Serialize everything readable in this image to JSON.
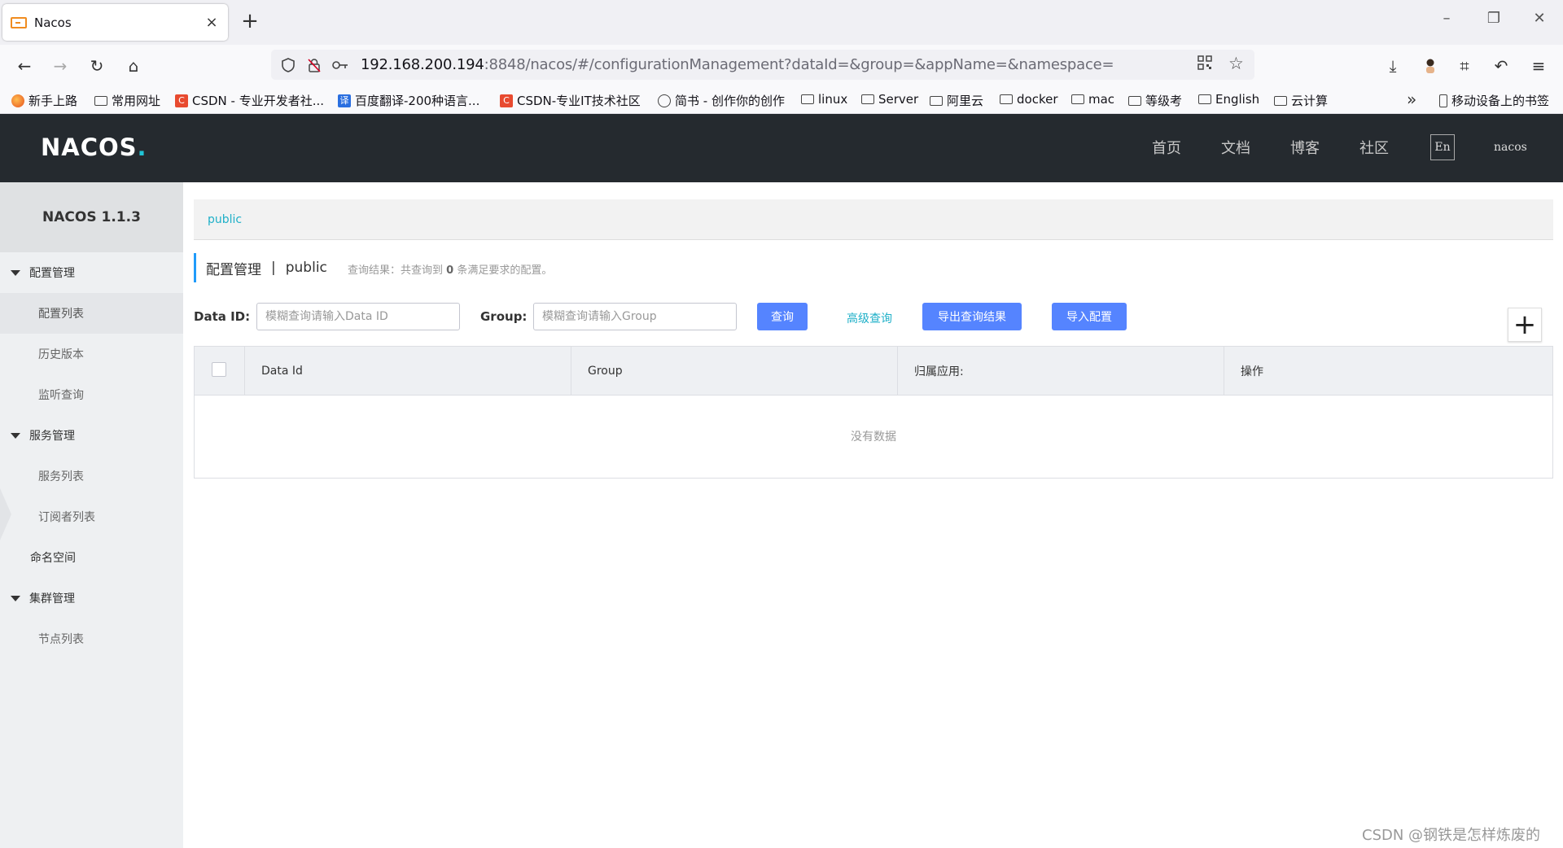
{
  "browser": {
    "tab_title": "Nacos",
    "tab_close": "×",
    "new_tab": "+",
    "url_host": "192.168.200.194",
    "url_rest": ":8848/nacos/#/configurationManagement?dataId=&group=&appName=&namespace=",
    "bookmarks": [
      {
        "label": "新手上路",
        "icon": "firefox-icon"
      },
      {
        "label": "常用网址",
        "icon": "folder-icon"
      },
      {
        "label": "CSDN - 专业开发者社...",
        "icon": "csdn-icon"
      },
      {
        "label": "百度翻译-200种语言...",
        "icon": "fanyi-icon"
      },
      {
        "label": "CSDN-专业IT技术社区",
        "icon": "csdn-icon"
      },
      {
        "label": "简书 - 创作你的创作",
        "icon": "globe-icon"
      },
      {
        "label": "linux",
        "icon": "folder-icon"
      },
      {
        "label": "Server",
        "icon": "folder-icon"
      },
      {
        "label": "阿里云",
        "icon": "folder-icon"
      },
      {
        "label": "docker",
        "icon": "folder-icon"
      },
      {
        "label": "mac",
        "icon": "folder-icon"
      },
      {
        "label": "等级考",
        "icon": "folder-icon"
      },
      {
        "label": "English",
        "icon": "folder-icon"
      },
      {
        "label": "云计算",
        "icon": "folder-icon"
      }
    ],
    "mobile_bookmarks": "移动设备上的书签"
  },
  "header": {
    "logo_text": "NACOS",
    "logo_dot": ".",
    "nav": [
      "首页",
      "文档",
      "博客",
      "社区"
    ],
    "lang": "En",
    "user": "nacos"
  },
  "sidebar": {
    "title": "NACOS 1.1.3",
    "groups": [
      {
        "label": "配置管理",
        "items": [
          "配置列表",
          "历史版本",
          "监听查询"
        ]
      },
      {
        "label": "服务管理",
        "items": [
          "服务列表",
          "订阅者列表"
        ]
      },
      {
        "label": "命名空间"
      },
      {
        "label": "集群管理",
        "items": [
          "节点列表"
        ]
      }
    ]
  },
  "main": {
    "namespace_tab": "public",
    "title": "配置管理",
    "title_sep": "|",
    "title_namespace": "public",
    "query_result_prefix": "查询结果：共查询到",
    "query_result_count": "0",
    "query_result_suffix": "条满足要求的配置。",
    "data_id_label": "Data ID:",
    "data_id_placeholder": "模糊查询请输入Data ID",
    "group_label": "Group:",
    "group_placeholder": "模糊查询请输入Group",
    "query_button": "查询",
    "advanced_query": "高级查询",
    "export_button": "导出查询结果",
    "import_button": "导入配置",
    "add_button": "+",
    "table": {
      "columns": [
        "Data Id",
        "Group",
        "归属应用:",
        "操作"
      ],
      "rows": [],
      "empty_text": "没有数据"
    }
  },
  "watermark": "CSDN @钢铁是怎样炼废的",
  "colors": {
    "header_bg": "#252a2f",
    "primary_button": "#5584ff",
    "link": "#1fb0c8",
    "title_accent": "#209bfa",
    "sidebar_bg": "#eef0f2"
  }
}
